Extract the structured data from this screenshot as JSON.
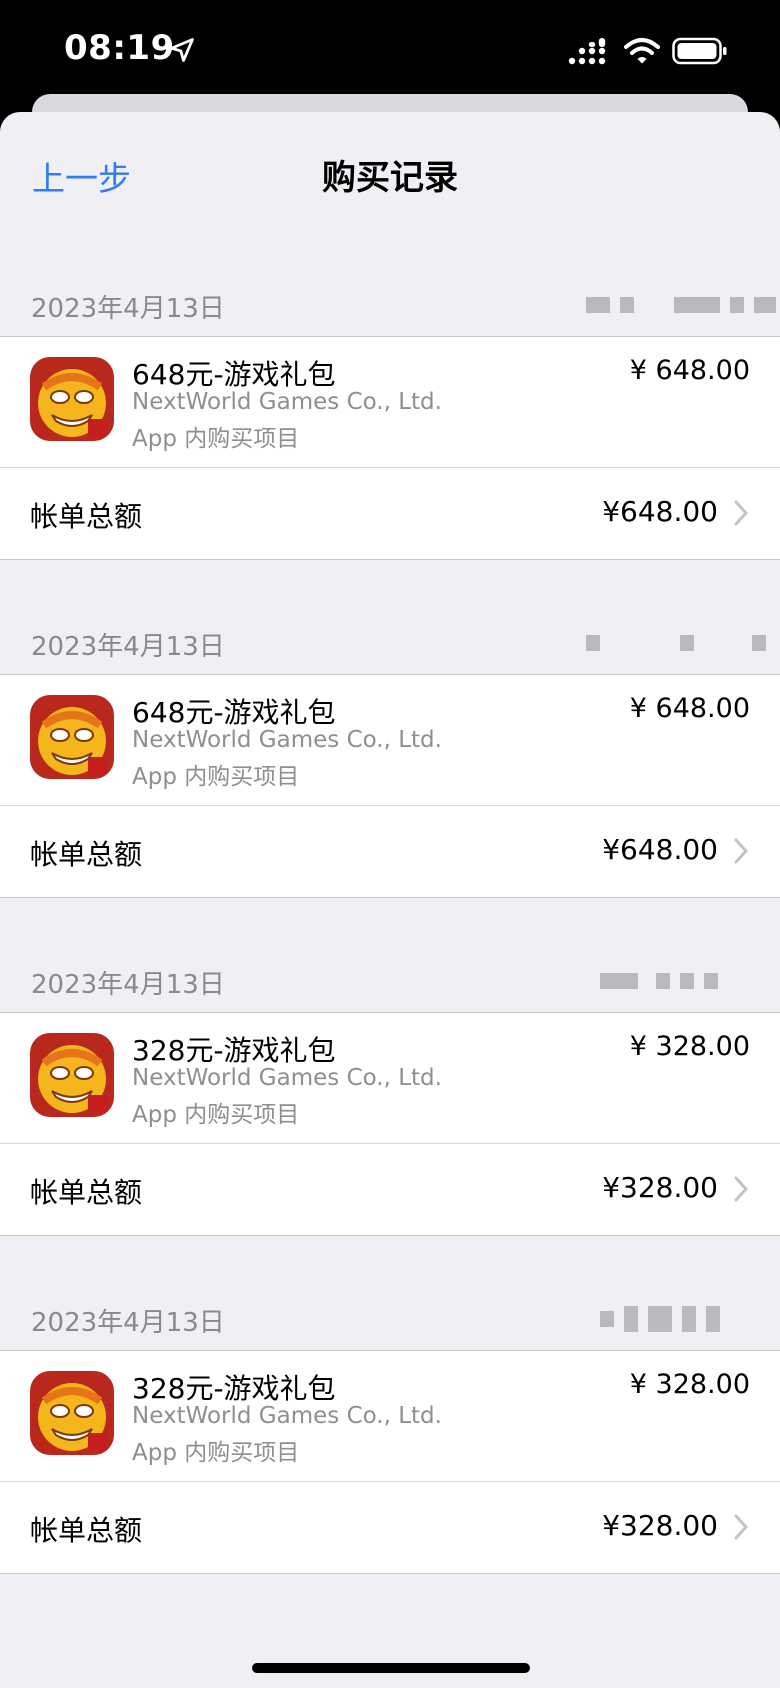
{
  "status_bar": {
    "time": "08:19"
  },
  "nav": {
    "back_label": "上一步",
    "title": "购买记录"
  },
  "colors": {
    "accent": "#2f7cf6",
    "background": "#efeff4",
    "secondary_text": "#8e8e93"
  },
  "purchases": [
    {
      "date": "2023年4月13日",
      "item_name": "648元-游戏礼包",
      "developer": "NextWorld Games Co., Ltd.",
      "type": "App 内购买项目",
      "price": "¥ 648.00",
      "total_label": "帐单总额",
      "total_value": "¥648.00"
    },
    {
      "date": "2023年4月13日",
      "item_name": "648元-游戏礼包",
      "developer": "NextWorld Games Co., Ltd.",
      "type": "App 内购买项目",
      "price": "¥ 648.00",
      "total_label": "帐单总额",
      "total_value": "¥648.00"
    },
    {
      "date": "2023年4月13日",
      "item_name": "328元-游戏礼包",
      "developer": "NextWorld Games Co., Ltd.",
      "type": "App 内购买项目",
      "price": "¥ 328.00",
      "total_label": "帐单总额",
      "total_value": "¥328.00"
    },
    {
      "date": "2023年4月13日",
      "item_name": "328元-游戏礼包",
      "developer": "NextWorld Games Co., Ltd.",
      "type": "App 内购买项目",
      "price": "¥ 328.00",
      "total_label": "帐单总额",
      "total_value": "¥328.00"
    }
  ]
}
